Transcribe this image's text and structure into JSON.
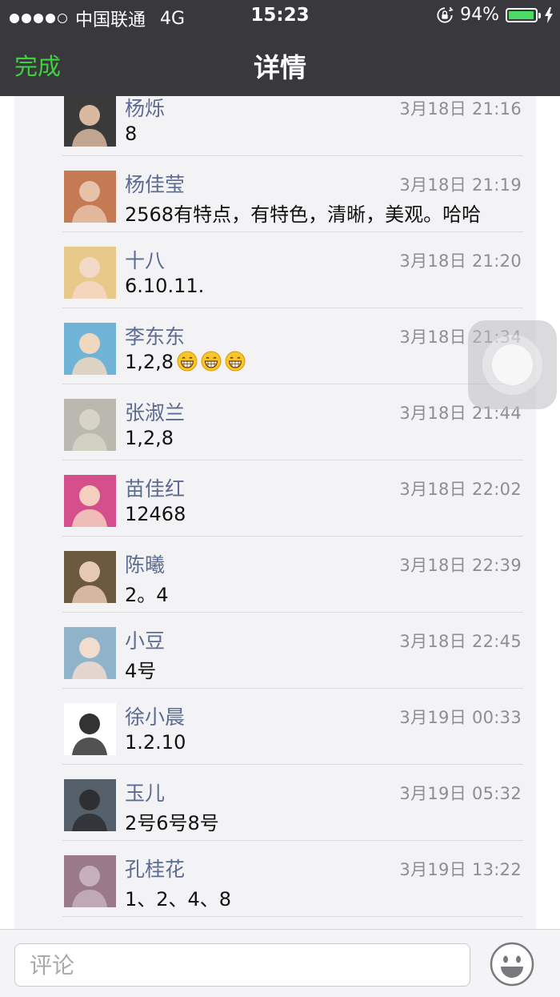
{
  "status_bar": {
    "carrier": "中国联通",
    "network": "4G",
    "time": "15:23",
    "battery": "94%",
    "battery_level": 0.94
  },
  "nav": {
    "done_label": "完成",
    "title": "详情"
  },
  "comments": [
    {
      "name": "杨烁",
      "time": "3月18日 21:16",
      "text": "8",
      "emoji_count": 0
    },
    {
      "name": "杨佳莹",
      "time": "3月18日 21:19",
      "text": "2568有特点，有特色，清晰，美观。哈哈",
      "emoji_count": 0
    },
    {
      "name": "十八",
      "time": "3月18日 21:20",
      "text": "6.10.11.",
      "emoji_count": 0
    },
    {
      "name": "李东东",
      "time": "3月18日 21:34",
      "text": "1,2,8",
      "emoji_count": 3
    },
    {
      "name": "张淑兰",
      "time": "3月18日 21:44",
      "text": "1,2,8",
      "emoji_count": 0
    },
    {
      "name": "苗佳红",
      "time": "3月18日 22:02",
      "text": "12468",
      "emoji_count": 0
    },
    {
      "name": "陈曦",
      "time": "3月18日 22:39",
      "text": "2。4",
      "emoji_count": 0
    },
    {
      "name": "小豆",
      "time": "3月18日 22:45",
      "text": "4号",
      "emoji_count": 0
    },
    {
      "name": "徐小晨",
      "time": "3月19日 00:33",
      "text": "1.2.10",
      "emoji_count": 0
    },
    {
      "name": "玉儿",
      "time": "3月19日 05:32",
      "text": "2号6号8号",
      "emoji_count": 0
    },
    {
      "name": "孔桂花",
      "time": "3月19日 13:22",
      "text": "1、2、4、8",
      "emoji_count": 0
    }
  ],
  "input": {
    "placeholder": "评论"
  },
  "colors": {
    "accent_green": "#3fd23f",
    "name_blue": "#5b6b91",
    "nav_bg": "#38383d"
  }
}
